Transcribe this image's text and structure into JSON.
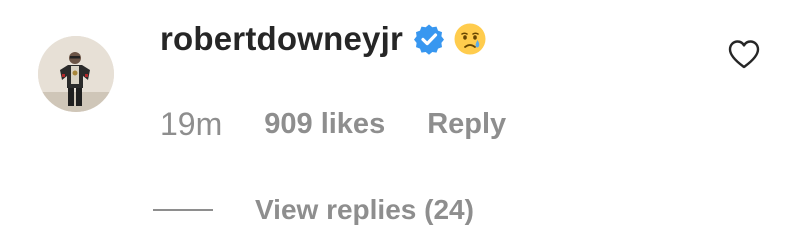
{
  "comment": {
    "username": "robertdowneyjr",
    "verified": true,
    "verified_icon": "verified-badge-icon",
    "emoji_icon": "crying-face-emoji-icon",
    "timestamp": "19m",
    "likes": "909 likes",
    "reply_label": "Reply",
    "like_icon": "heart-outline-icon"
  },
  "replies": {
    "label": "View replies (24)"
  },
  "colors": {
    "text_primary": "#262626",
    "text_secondary": "#8e8e8e",
    "verified_blue": "#3897f0",
    "background": "#ffffff"
  }
}
